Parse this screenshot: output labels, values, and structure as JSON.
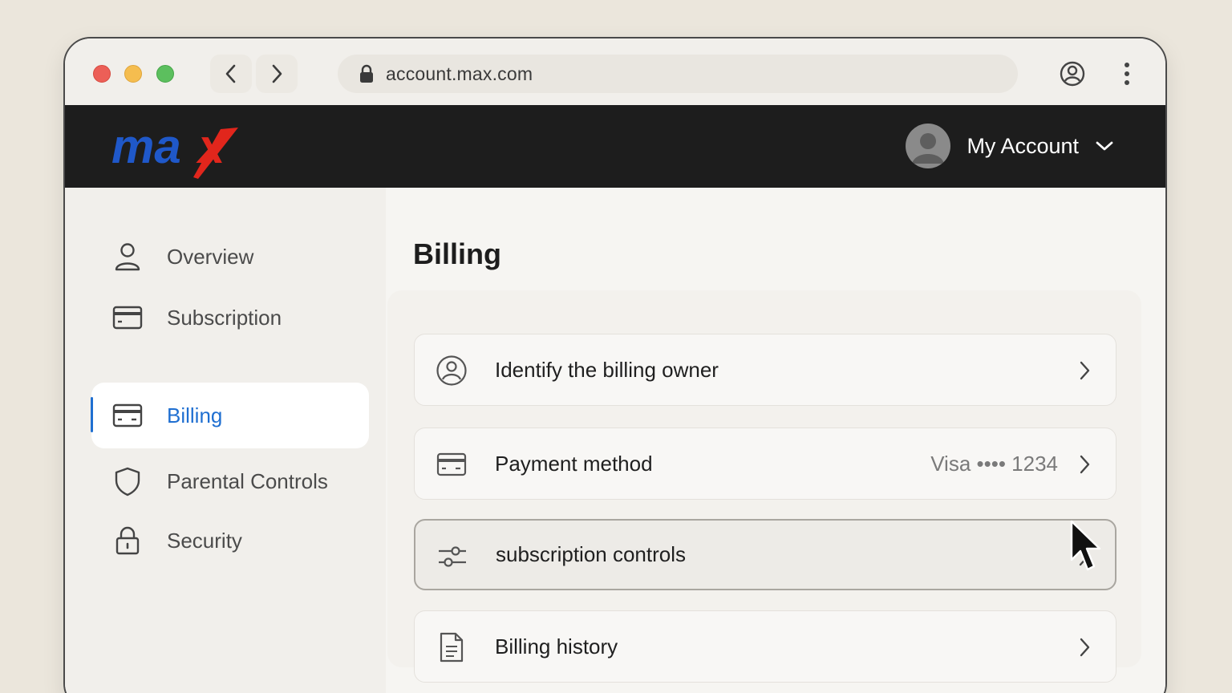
{
  "browser": {
    "url": "account.max.com",
    "icons": {
      "back": "chevron-left-icon",
      "forward": "chevron-right-icon",
      "lock": "lock-icon",
      "profile": "profile-icon",
      "menu": "kebab-icon"
    }
  },
  "header": {
    "logo_text": "max",
    "account_label": "My Account",
    "colors": {
      "bar": "#1d1d1d",
      "logo_blue": "#1f58c9",
      "logo_red": "#e1261c"
    }
  },
  "sidebar": {
    "items": [
      {
        "label": "Overview",
        "icon": "user-icon",
        "active": false
      },
      {
        "label": "Subscription",
        "icon": "card-icon",
        "active": false
      },
      {
        "label": "Billing",
        "icon": "card-icon",
        "active": true
      },
      {
        "label": "Parental Controls",
        "icon": "shield-icon",
        "active": false
      },
      {
        "label": "Security",
        "icon": "lock-icon",
        "active": false
      }
    ],
    "accent": "#1f6fd1"
  },
  "main": {
    "title": "Billing",
    "rows": [
      {
        "label": "Identify the billing owner",
        "value": "",
        "icon": "user-circle-icon"
      },
      {
        "label": "Payment method",
        "value": "Visa •••• 1234",
        "icon": "card-icon"
      },
      {
        "label": "subscription controls",
        "value": "",
        "icon": "sliders-icon",
        "hovered": true
      },
      {
        "label": "Billing history",
        "value": "",
        "icon": "document-icon"
      }
    ]
  }
}
